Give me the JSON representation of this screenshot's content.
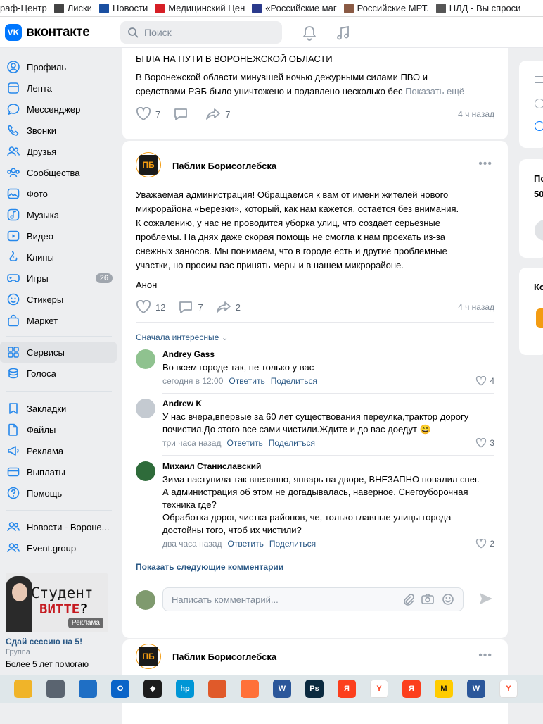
{
  "bookmarks": [
    {
      "label": "раф-Центр",
      "color": "#f2a33a",
      "icon": "folder-icon"
    },
    {
      "label": "Лиски",
      "color": "#444444",
      "icon": "page-icon"
    },
    {
      "label": "Новости",
      "color": "#1a4fa1",
      "icon": "news-icon"
    },
    {
      "label": "Медицинский Цен",
      "color": "#d61f26",
      "icon": "red-cross-icon"
    },
    {
      "label": "«Российские маг",
      "color": "#2b3a8c",
      "icon": "shop-icon"
    },
    {
      "label": "Российские МРТ.",
      "color": "#8a5a44",
      "icon": "person-icon"
    },
    {
      "label": "НЛД - Вы спроси",
      "color": "#555555",
      "icon": "page-icon"
    }
  ],
  "header": {
    "logo_text": "вконтакте",
    "logo_badge": "VK",
    "search_placeholder": "Поиск"
  },
  "sidebar": {
    "items": [
      {
        "label": "Профиль",
        "icon": "profile-icon"
      },
      {
        "label": "Лента",
        "icon": "feed-icon"
      },
      {
        "label": "Мессенджер",
        "icon": "messenger-icon"
      },
      {
        "label": "Звонки",
        "icon": "phone-icon"
      },
      {
        "label": "Друзья",
        "icon": "friends-icon"
      },
      {
        "label": "Сообщества",
        "icon": "communities-icon"
      },
      {
        "label": "Фото",
        "icon": "photo-icon"
      },
      {
        "label": "Музыка",
        "icon": "music-icon"
      },
      {
        "label": "Видео",
        "icon": "video-icon"
      },
      {
        "label": "Клипы",
        "icon": "clips-icon"
      },
      {
        "label": "Игры",
        "icon": "games-icon",
        "badge": "26"
      },
      {
        "label": "Стикеры",
        "icon": "stickers-icon"
      },
      {
        "label": "Маркет",
        "icon": "market-icon"
      }
    ],
    "items2": [
      {
        "label": "Сервисы",
        "icon": "services-icon",
        "active": true
      },
      {
        "label": "Голоса",
        "icon": "votes-icon"
      }
    ],
    "items3": [
      {
        "label": "Закладки",
        "icon": "bookmarks-icon"
      },
      {
        "label": "Файлы",
        "icon": "files-icon"
      },
      {
        "label": "Реклама",
        "icon": "ads-icon"
      },
      {
        "label": "Выплаты",
        "icon": "payments-icon"
      },
      {
        "label": "Помощь",
        "icon": "help-icon"
      }
    ],
    "items4": [
      {
        "label": "Новости - Вороне...",
        "icon": "group-icon"
      },
      {
        "label": "Event.group",
        "icon": "group-icon"
      }
    ]
  },
  "ad": {
    "line1": "Студент",
    "line2a": "ВИТТЕ",
    "line2b": "?",
    "tag": "Реклама",
    "title": "Сдай сессию на 5!",
    "subtitle": "Группа",
    "desc": "Более 5 лет помогаю"
  },
  "post1": {
    "title": "БПЛА НА ПУТИ В ВОРОНЕЖСКОЙ ОБЛАСТИ",
    "text1": "В Воронежской области минувшей ночью дежурными силами ПВО и",
    "text2": "средствами РЭБ было уничтожено и подавлено несколько бес",
    "more": "Показать ещё",
    "likes": "7",
    "shares": "7",
    "time": "4 ч назад"
  },
  "post2": {
    "author": "Паблик Борисоглебска",
    "avatar_text": "ПБ",
    "lines": [
      "Уважаемая администрация! Обращаемся к вам от имени жителей нового",
      "микрорайона «Берёзки», который, как нам кажется, остаётся без внимания.",
      "К сожалению, у нас не проводится уборка улиц, что создаёт серьёзные",
      "проблемы. На днях даже скорая помощь не смогла к нам проехать из-за",
      "снежных заносов. Мы понимаем, что в городе есть и другие проблемные",
      "участки, но просим вас принять меры и в нашем микрорайоне."
    ],
    "signature": "Анон",
    "likes": "12",
    "comments": "7",
    "shares": "2",
    "time": "4 ч назад",
    "sort_label": "Сначала интересные",
    "show_more": "Показать следующие комментарии",
    "comment_placeholder": "Написать комментарий...",
    "comments_list": [
      {
        "name": "Andrey Gass",
        "lines": [
          "Во всем городе так, не только у вас"
        ],
        "time": "сегодня в 12:00",
        "reply": "Ответить",
        "share": "Поделиться",
        "likes": "4",
        "avatar_color": "#8fc28f"
      },
      {
        "name": "Andrew K",
        "lines": [
          "У нас вчера,впервые за 60 лет существования переулка,трактор дорогу",
          "почистил.До этого все сами чистили.Ждите и до вас доедут 😄"
        ],
        "time": "три часа назад",
        "reply": "Ответить",
        "share": "Поделиться",
        "likes": "3",
        "avatar_color": "#c4cad1"
      },
      {
        "name": "Михаил Станиславский",
        "lines": [
          "Зима наступила так внезапно, январь на дворе, ВНЕЗАПНО повалил снег.",
          "А администрация об этом не догадывалась, наверное. Снегоуборочная",
          "техника где?",
          "Обработка дорог, чистка районов, че, только главные улицы города",
          "достойны того, чтоб их чистили?"
        ],
        "time": "два часа назад",
        "reply": "Ответить",
        "share": "Поделиться",
        "likes": "2",
        "avatar_color": "#2e6b3a"
      }
    ]
  },
  "post3": {
    "author": "Паблик Борисоглебска",
    "avatar_text": "ПБ"
  },
  "rightcol": {
    "cut1": "По",
    "cut2": "50",
    "cut3": "Ко"
  },
  "taskbar": [
    {
      "icon": "file-explorer-icon",
      "color": "#f0b429",
      "text": ""
    },
    {
      "icon": "calculator-icon",
      "color": "#5a6470",
      "text": ""
    },
    {
      "icon": "store-icon",
      "color": "#1f6fc5",
      "text": ""
    },
    {
      "icon": "outlook-icon",
      "color": "#0a64c8",
      "text": "O"
    },
    {
      "icon": "dropbox-icon",
      "color": "#1d1d1d",
      "text": "❖"
    },
    {
      "icon": "hp-icon",
      "color": "#0096d6",
      "text": "hp"
    },
    {
      "icon": "paint-icon",
      "color": "#e05a2a",
      "text": ""
    },
    {
      "icon": "firefox-icon",
      "color": "#ff7139",
      "text": ""
    },
    {
      "icon": "word-icon",
      "color": "#2b579a",
      "text": "W"
    },
    {
      "icon": "photoshop-icon",
      "color": "#0b2a3f",
      "text": "Ps"
    },
    {
      "icon": "yandex-icon",
      "color": "#fc3f1d",
      "text": "Я"
    },
    {
      "icon": "yandex-browser-icon",
      "color": "#ffffff",
      "text": "Y"
    },
    {
      "icon": "yandex-icon",
      "color": "#fc3f1d",
      "text": "Я"
    },
    {
      "icon": "yandex-market-icon",
      "color": "#ffcc00",
      "text": "M"
    },
    {
      "icon": "word-icon",
      "color": "#2b579a",
      "text": "W"
    },
    {
      "icon": "yandex-browser-icon",
      "color": "#ffffff",
      "text": "Y"
    }
  ]
}
